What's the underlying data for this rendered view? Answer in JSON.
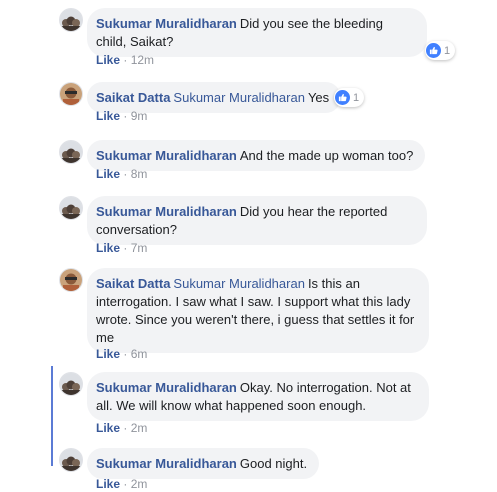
{
  "comments": [
    {
      "author": "Sukumar Muralidharan",
      "mention": "",
      "text": "Did you see the bleeding child, Saikat?",
      "like": "Like",
      "time": "12m",
      "reactions": "1"
    },
    {
      "author": "Saikat Datta",
      "mention": "Sukumar Muralidharan",
      "text": "Yes",
      "like": "Like",
      "time": "9m",
      "reactions": "1"
    },
    {
      "author": "Sukumar Muralidharan",
      "mention": "",
      "text": "And the made up woman too?",
      "like": "Like",
      "time": "8m"
    },
    {
      "author": "Sukumar Muralidharan",
      "mention": "",
      "text": "Did you hear the reported conversation?",
      "like": "Like",
      "time": "7m"
    },
    {
      "author": "Saikat Datta",
      "mention": "Sukumar Muralidharan",
      "text": "Is this an interrogation. I saw what I saw. I support what this lady wrote. Since you weren't there, i guess that settles it for me",
      "like": "Like",
      "time": "6m"
    },
    {
      "author": "Sukumar Muralidharan",
      "mention": "",
      "text": "Okay. No interrogation. Not at all. We will know what happened soon enough.",
      "like": "Like",
      "time": "2m"
    },
    {
      "author": "Sukumar Muralidharan",
      "mention": "",
      "text": "Good night.",
      "like": "Like",
      "time": "2m"
    }
  ],
  "meta": {
    "separator": "·"
  },
  "colors": {
    "link": "#385898",
    "bubble": "#f2f3f5",
    "like_badge": "#4080ff",
    "thread_line": "#5b7bd5"
  }
}
